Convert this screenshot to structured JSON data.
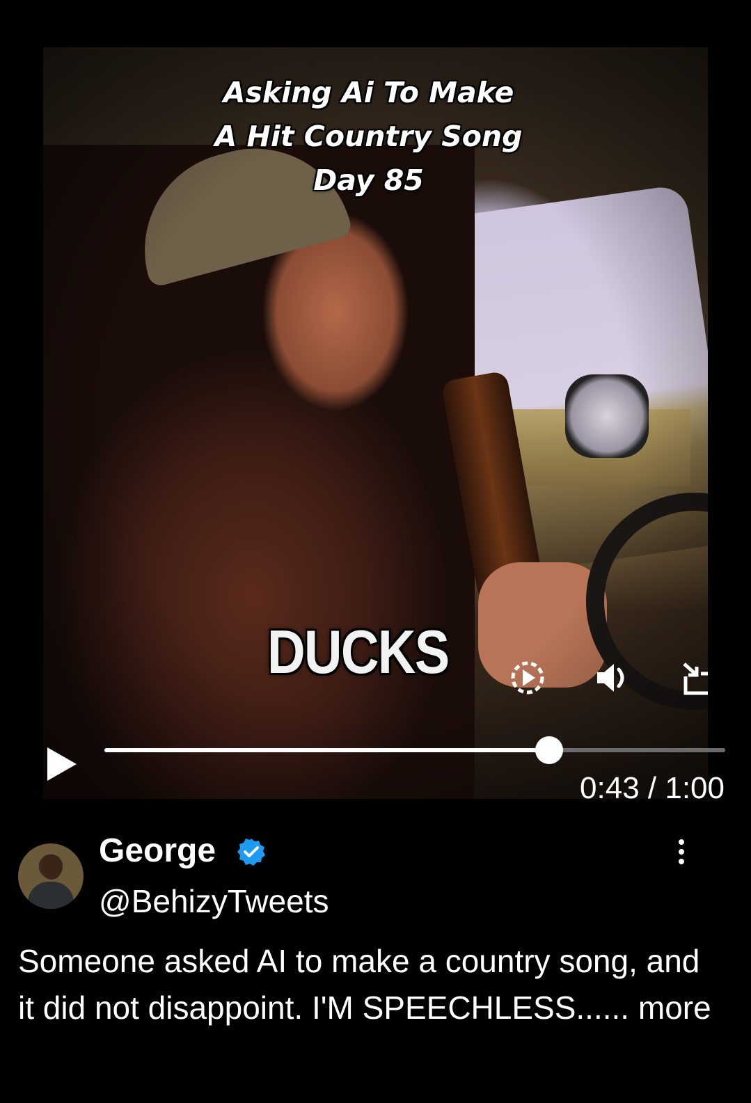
{
  "video": {
    "overlay_title_lines": [
      "Asking Ai To Make",
      "A Hit Country Song",
      "Day 85"
    ],
    "caption": "DUCKS",
    "progress_fraction": 0.716,
    "time_display": "0:43 / 1:00",
    "icons": [
      "autoplay-icon",
      "volume-icon",
      "minimize-icon",
      "play-icon"
    ]
  },
  "tweet": {
    "author_name": "George",
    "author_handle": "@BehizyTweets",
    "verified": true,
    "text": "Someone asked AI to make a country song, and it did not disappoint. I'M SPEECHLESS......",
    "more_label": "more"
  },
  "colors": {
    "background": "#000000",
    "verified_badge": "#1d9bf0",
    "progress_track": "#6b6b6b",
    "progress_fill": "#ffffff"
  }
}
